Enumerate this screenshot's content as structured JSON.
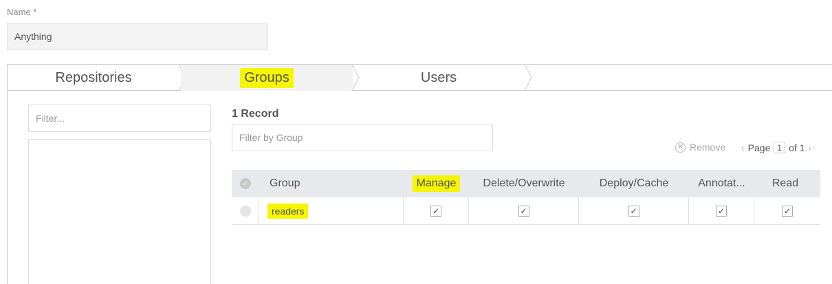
{
  "form": {
    "name_label": "Name *",
    "name_value": "Anything"
  },
  "tabs": [
    {
      "label": "Repositories",
      "active": false
    },
    {
      "label": "Groups",
      "active": true,
      "highlighted": true
    },
    {
      "label": "Users",
      "active": false
    }
  ],
  "left_panel": {
    "filter_placeholder": "Filter..."
  },
  "groups_panel": {
    "record_count": "1 Record",
    "filter_placeholder": "Filter by Group",
    "remove_label": "Remove",
    "pager": {
      "page_label": "Page",
      "current": "1",
      "of_label": "of 1"
    }
  },
  "table": {
    "columns": [
      "Group",
      "Manage",
      "Delete/Overwrite",
      "Deploy/Cache",
      "Annotat...",
      "Read"
    ],
    "rows": [
      {
        "group": "readers",
        "manage": true,
        "delete_overwrite": true,
        "deploy_cache": true,
        "annotate": true,
        "read": true
      }
    ]
  },
  "colors": {
    "highlight": "#f6f600",
    "header_bg": "#e7e9ec",
    "active_tab_bg": "#f2f2f2"
  },
  "icons": {
    "check": "✓",
    "remove": "⊗",
    "chevron_left": "‹",
    "chevron_right": "›"
  }
}
